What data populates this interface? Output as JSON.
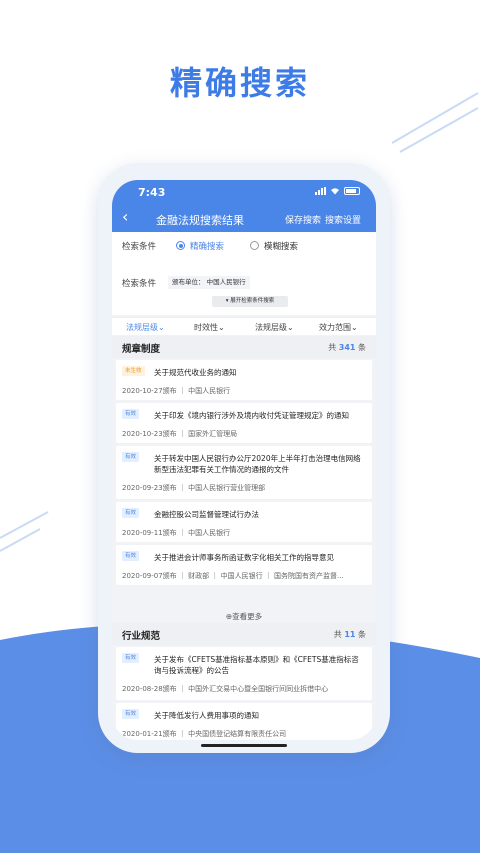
{
  "headline": "精确搜索",
  "colors": {
    "accent": "#4a86e8",
    "headline": "#3d7be6",
    "pending": "#e39a2d",
    "wave": "#5b8ee6"
  },
  "status_bar": {
    "time": "7:43"
  },
  "nav": {
    "title": "金融法规搜索结果",
    "save_label": "保存搜索",
    "settings_label": "搜索设置"
  },
  "search": {
    "mode_label": "检索条件",
    "modes": [
      {
        "label": "精确搜索",
        "selected": true
      },
      {
        "label": "模糊搜索",
        "selected": false
      }
    ],
    "condition_label": "检索条件",
    "condition_tag": "颁布单位： 中国人民银行",
    "expand_label": "▾  展开检索条件搜索"
  },
  "filters": [
    {
      "label": "法规层级⌄",
      "active": true
    },
    {
      "label": "时效性⌄",
      "active": false
    },
    {
      "label": "法规层级⌄",
      "active": false
    },
    {
      "label": "效力范围⌄",
      "active": false
    }
  ],
  "sections": [
    {
      "title": "规章制度",
      "count_prefix": "共",
      "count": "341",
      "count_suffix": "条",
      "items": [
        {
          "badge": "未生效",
          "title": "关于规范代收业务的通知",
          "meta": "2020-10-27颁布 ｜ 中国人民银行"
        },
        {
          "badge": "有效",
          "title": "关于印发《境内银行涉外及境内收付凭证管理规定》的通知",
          "meta": "2020-10-23颁布 ｜ 国家外汇管理局"
        },
        {
          "badge": "有效",
          "title": "关于转发中国人民银行办公厅2020年上半年打击治理电信网络新型违法犯罪有关工作情况的通报的文件",
          "meta": "2020-09-23颁布 ｜ 中国人民银行营业管理部"
        },
        {
          "badge": "有效",
          "title": "金融控股公司监督管理试行办法",
          "meta": "2020-09-11颁布 ｜ 中国人民银行"
        },
        {
          "badge": "有效",
          "title": "关于推进会计师事务所函证数字化相关工作的指导意见",
          "meta": "2020-09-07颁布 ｜ 财政部 ｜ 中国人民银行 ｜ 国务院国有资产监督..."
        }
      ],
      "more_label": "⊕查看更多"
    },
    {
      "title": "行业规范",
      "count_prefix": "共",
      "count": "11",
      "count_suffix": "条",
      "items": [
        {
          "badge": "有效",
          "title": "关于发布《CFETS基准指标基本原则》和《CFETS基准指标咨询与投诉流程》的公告",
          "meta": "2020-08-28颁布 ｜ 中国外汇交易中心暨全国银行间同业拆借中心"
        },
        {
          "badge": "有效",
          "title": "关于降低发行人费用事项的通知",
          "meta": "2020-01-21颁布 ｜ 中央国债登记结算有限责任公司"
        }
      ]
    }
  ]
}
